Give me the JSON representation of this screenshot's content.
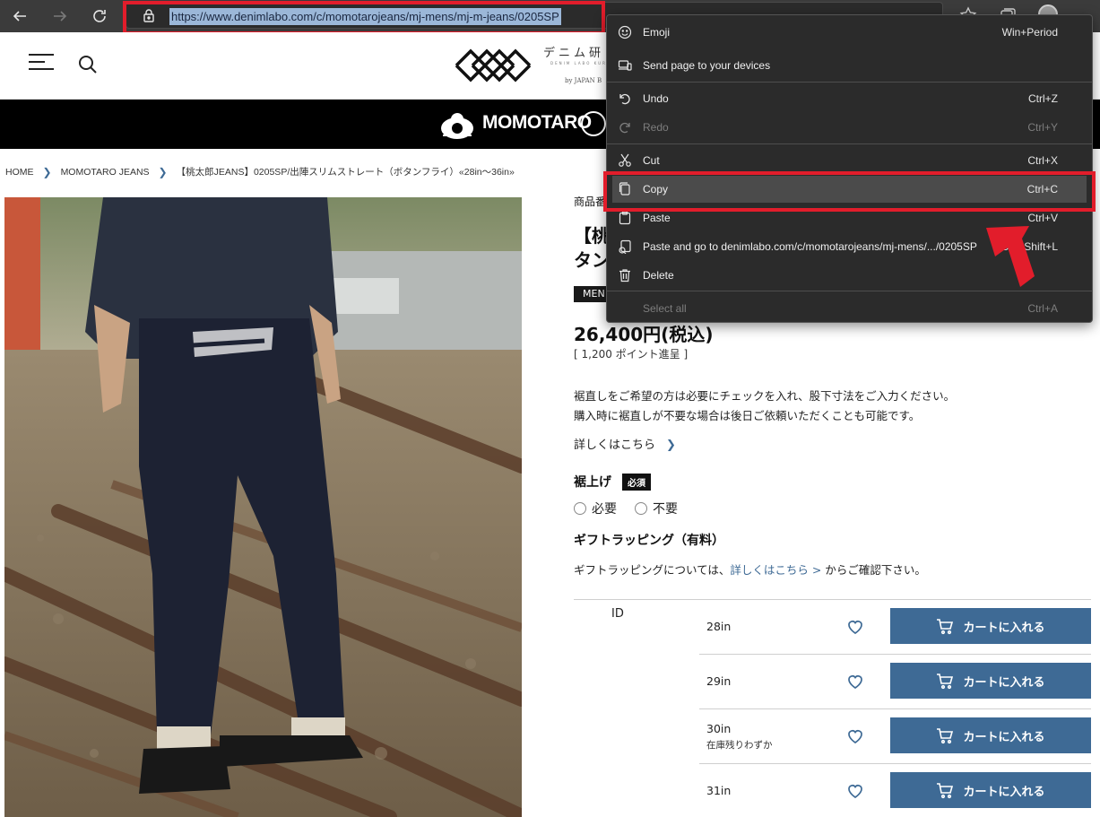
{
  "browser": {
    "url": "https://www.denimlabo.com/c/momotarojeans/mj-mens/mj-m-jeans/0205SP"
  },
  "site": {
    "logo_text": "デニム研",
    "logo_sub": "DENIM LABO KURASHIKI",
    "logo_by": "by JAPAN B",
    "brand_name": "MOMOTARO"
  },
  "breadcrumb": [
    "HOME",
    "MOMOTARO JEANS",
    "【桃太郎JEANS】0205SP/出陣スリムストレート（ボタンフライ）«28in～36in»"
  ],
  "product": {
    "product_label_partial": "商品番",
    "title_line1_partial": "【桃",
    "title_line2_partial": "タン",
    "category_partial": "MEN",
    "price": "26,400円(税込)",
    "points": "[ 1,200 ポイント進呈 ]",
    "desc_line1": "裾直しをご希望の方は必要にチェックを入れ、股下寸法をご入力ください。",
    "desc_line2": "購入時に裾直しが不要な場合は後日ご依頼いただくことも可能です。",
    "more_link": "詳しくはこちら",
    "hem_label": "裾上げ",
    "required_badge": "必須",
    "options": [
      "必要",
      "不要"
    ],
    "gift_title": "ギフトラッピング（有料）",
    "gift_text_before": "ギフトラッピングについては、",
    "gift_link": "詳しくはこちら >",
    "gift_text_after": " からご確認下さい。",
    "id_label": "ID",
    "cart_label": "カートに入れる",
    "sizes": [
      {
        "size": "28in",
        "note": ""
      },
      {
        "size": "29in",
        "note": ""
      },
      {
        "size": "30in",
        "note": "在庫残りわずか"
      },
      {
        "size": "31in",
        "note": ""
      }
    ]
  },
  "context_menu": {
    "items": [
      {
        "label": "Emoji",
        "shortcut": "Win+Period",
        "icon": "emoji-icon",
        "enabled": true
      },
      {
        "label": "Send page to your devices",
        "shortcut": "",
        "icon": "devices-icon",
        "enabled": true
      },
      {
        "label": "Undo",
        "shortcut": "Ctrl+Z",
        "icon": "undo-icon",
        "enabled": true
      },
      {
        "label": "Redo",
        "shortcut": "Ctrl+Y",
        "icon": "redo-icon",
        "enabled": false
      },
      {
        "label": "Cut",
        "shortcut": "Ctrl+X",
        "icon": "scissors-icon",
        "enabled": true
      },
      {
        "label": "Copy",
        "shortcut": "Ctrl+C",
        "icon": "copy-icon",
        "enabled": true,
        "selected": true
      },
      {
        "label": "Paste",
        "shortcut": "Ctrl+V",
        "icon": "paste-icon",
        "enabled": true
      },
      {
        "label": "Paste and go to denimlabo.com/c/momotarojeans/mj-mens/.../0205SP",
        "shortcut": "Ctrl+Shift+L",
        "icon": "paste-go-icon",
        "enabled": true
      },
      {
        "label": "Delete",
        "shortcut": "",
        "icon": "trash-icon",
        "enabled": true
      },
      {
        "label": "Select all",
        "shortcut": "Ctrl+A",
        "icon": "",
        "enabled": false
      }
    ]
  },
  "colors": {
    "accent_blue": "#3e6a95",
    "highlight_red": "#e21d2b",
    "menu_bg": "#2b2b2b"
  }
}
